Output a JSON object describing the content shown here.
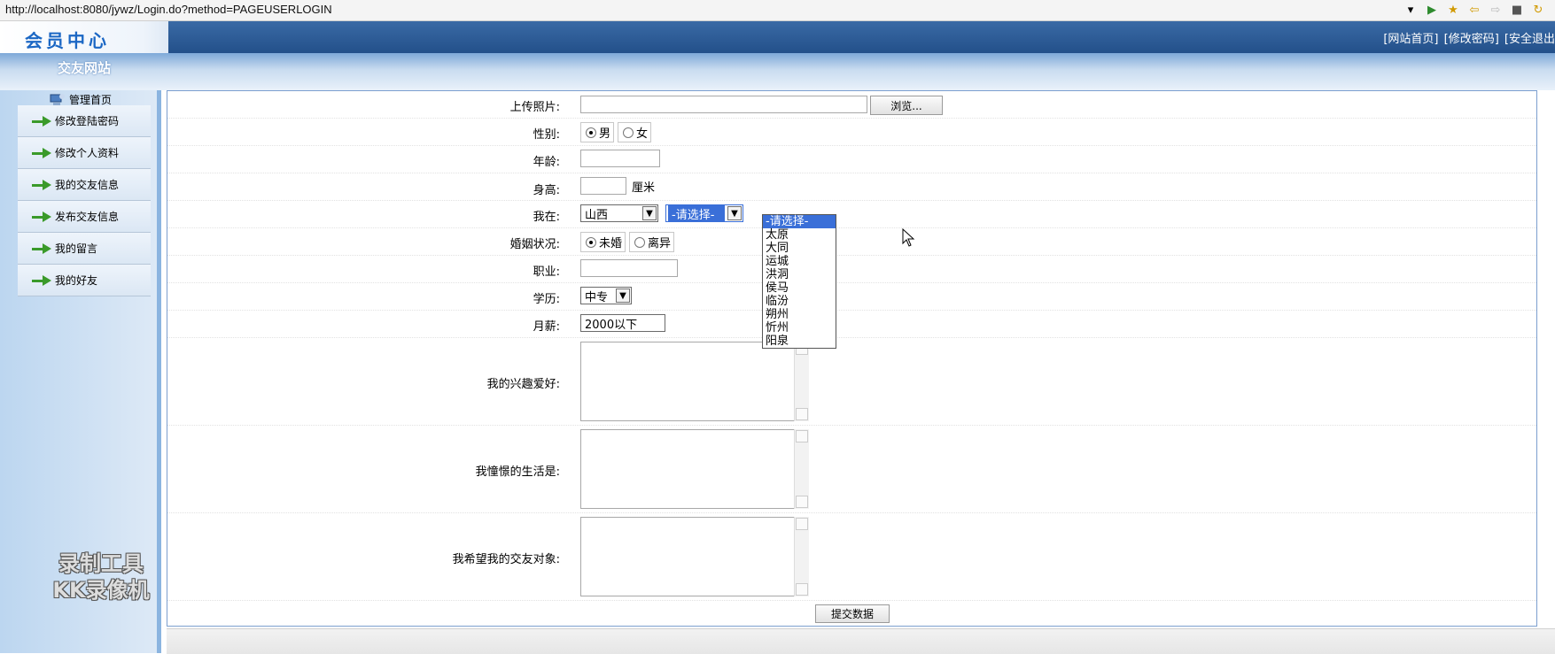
{
  "browser": {
    "url": "http://localhost:8080/jywz/Login.do?method=PAGEUSERLOGIN"
  },
  "header": {
    "logo_text": "会员中心",
    "site_name": "交友网站",
    "links": [
      "[网站首页]",
      "[修改密码]",
      "[安全退出"
    ]
  },
  "sidebar": {
    "home_label": "管理首页",
    "items": [
      {
        "label": "修改登陆密码"
      },
      {
        "label": "修改个人资料"
      },
      {
        "label": "我的交友信息"
      },
      {
        "label": "发布交友信息"
      },
      {
        "label": "我的留言"
      },
      {
        "label": "我的好友"
      }
    ],
    "watermark": [
      "录制工具",
      "KK录像机"
    ]
  },
  "form": {
    "photo": {
      "label": "上传照片:",
      "button": "浏览..."
    },
    "gender": {
      "label": "性别:",
      "options": [
        "男",
        "女"
      ],
      "selected": "男"
    },
    "age": {
      "label": "年龄:"
    },
    "height": {
      "label": "身高:",
      "unit": "厘米"
    },
    "location": {
      "label": "我在:",
      "province": "山西",
      "city_selected": "-请选择-",
      "city_options": [
        "-请选择-",
        "太原",
        "大同",
        "运城",
        "洪洞",
        "侯马",
        "临汾",
        "朔州",
        "忻州",
        "阳泉"
      ]
    },
    "marriage": {
      "label": "婚姻状况:",
      "options": [
        "未婚",
        "离异"
      ],
      "selected": "未婚"
    },
    "job": {
      "label": "职业:"
    },
    "education": {
      "label": "学历:",
      "value": "中专"
    },
    "salary": {
      "label": "月薪:",
      "value": "2000以下"
    },
    "hobby": {
      "label": "我的兴趣爱好:"
    },
    "life": {
      "label": "我憧憬的生活是:"
    },
    "target": {
      "label": "我希望我的交友对象:"
    },
    "submit": "提交数据"
  }
}
